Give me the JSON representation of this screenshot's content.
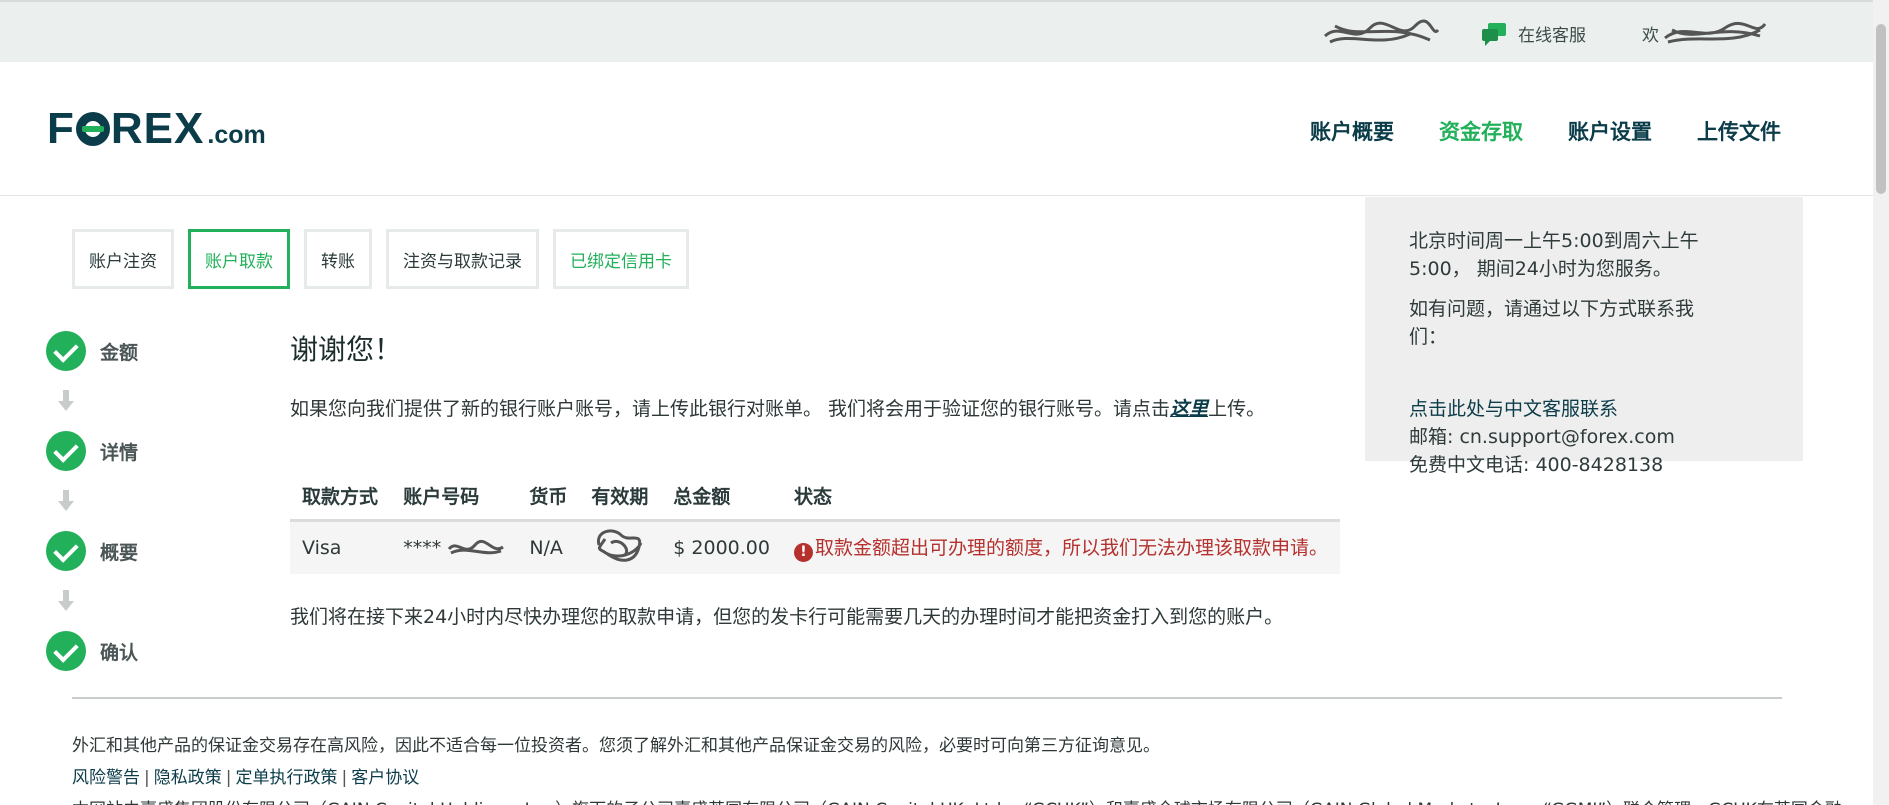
{
  "topbar": {
    "support_label": "在线客服",
    "username_visible": "欢"
  },
  "header": {
    "logo_main": "F",
    "logo_rest": "REX",
    "logo_suffix": ".com",
    "nav": [
      {
        "label": "账户概要"
      },
      {
        "label": "资金存取"
      },
      {
        "label": "账户设置"
      },
      {
        "label": "上传文件"
      }
    ],
    "active_nav": "资金存取"
  },
  "subtabs": [
    {
      "label": "账户注资"
    },
    {
      "label": "账户取款"
    },
    {
      "label": "转账"
    },
    {
      "label": "注资与取款记录"
    },
    {
      "label": "已绑定信用卡"
    }
  ],
  "steps": [
    {
      "label": "金额"
    },
    {
      "label": "详情"
    },
    {
      "label": "概要"
    },
    {
      "label": "确认"
    }
  ],
  "content": {
    "title": "谢谢您！",
    "intro_before": "如果您向我们提供了新的银行账户账号，请上传此银行对账单。 我们将会用于验证您的银行账号。请点击",
    "intro_link": "这里",
    "intro_after": "上传。",
    "table": {
      "headers": [
        "取款方式",
        "账户号码",
        "货币",
        "有效期",
        "总金额",
        "状态"
      ],
      "row": {
        "method": "Visa",
        "account": "****",
        "currency": "N/A",
        "amount": "$ 2000.00",
        "status": "取款金额超出可办理的额度，所以我们无法办理该取款申请。"
      }
    },
    "notice": "我们将在接下来24小时内尽快办理您的取款申请，但您的发卡行可能需要几天的办理时间才能把资金打入到您的账户。"
  },
  "infobox": {
    "hours": "北京时间周一上午5:00到周六上午5:00， 期间24小时为您服务。",
    "contact_prompt": "如有问题，请通过以下方式联系我们：",
    "chinese_support_link": "点击此处与中文客服联系",
    "email": "邮箱: cn.support@forex.com",
    "phone": "免费中文电话: 400-8428138"
  },
  "footer": {
    "disclaimer": "外汇和其他产品的保证金交易存在高风险，因此不适合每一位投资者。您须了解外汇和其他产品保证金交易的风险，必要时可向第三方征询意见。",
    "links": [
      "风险警告",
      "隐私政策",
      "定单执行政策",
      "客户协议"
    ],
    "legal_partial": "本网站由嘉盛集团股份有限公司（GAIN Capital Holdings, Inc.）旗下的子公司嘉盛英国有限公司（GAIN Capital UK, Ltd.，“GCUK”）和嘉盛全球市场有限公司（GAIN Global Markets, Inc.，“GGMI”）联合管理。GCUK在英国金融"
  },
  "colors": {
    "brand_navy": "#0b3c49",
    "brand_green": "#22b05a",
    "error_red": "#b5312e",
    "topbar_bg": "#ebf0ef",
    "infobox_bg": "#eeeeee"
  }
}
